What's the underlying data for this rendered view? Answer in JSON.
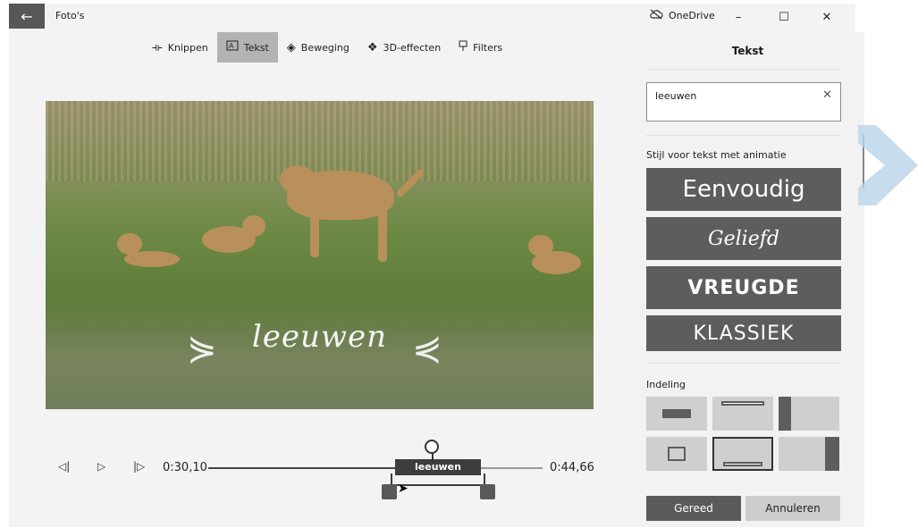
{
  "app": {
    "title": "Foto's",
    "back_icon": "arrow-left-icon"
  },
  "window": {
    "cloud_label": "OneDrive",
    "minimize": "–",
    "maximize": "☐",
    "close": "✕"
  },
  "toolbar": {
    "items": [
      {
        "label": "Knippen",
        "icon": "trim-icon",
        "active": false
      },
      {
        "label": "Tekst",
        "icon": "text-icon",
        "active": true
      },
      {
        "label": "Beweging",
        "icon": "motion-icon",
        "active": false
      },
      {
        "label": "3D-effecten",
        "icon": "3d-effects-icon",
        "active": false
      },
      {
        "label": "Filters",
        "icon": "filter-icon",
        "active": false
      }
    ]
  },
  "video": {
    "overlay_text": "leeuwen"
  },
  "timeline": {
    "current_time": "0:30,10",
    "end_time": "0:44,66",
    "caption": "leeuwen",
    "progress": 0.68
  },
  "panel": {
    "title": "Tekst",
    "search_value": "leeuwen",
    "clear_icon": "✕",
    "style_section": "Stijl voor tekst met animatie",
    "styles": [
      "Eenvoudig",
      "Geliefd",
      "VREUGDE",
      "KLASSIEK"
    ],
    "layout_section": "Indeling",
    "done_label": "Gereed",
    "cancel_label": "Annuleren"
  },
  "colors": {
    "accent": "#5d5d5d",
    "selected_tool": "#b3b3b3",
    "watermark": "#b9d4e8"
  }
}
